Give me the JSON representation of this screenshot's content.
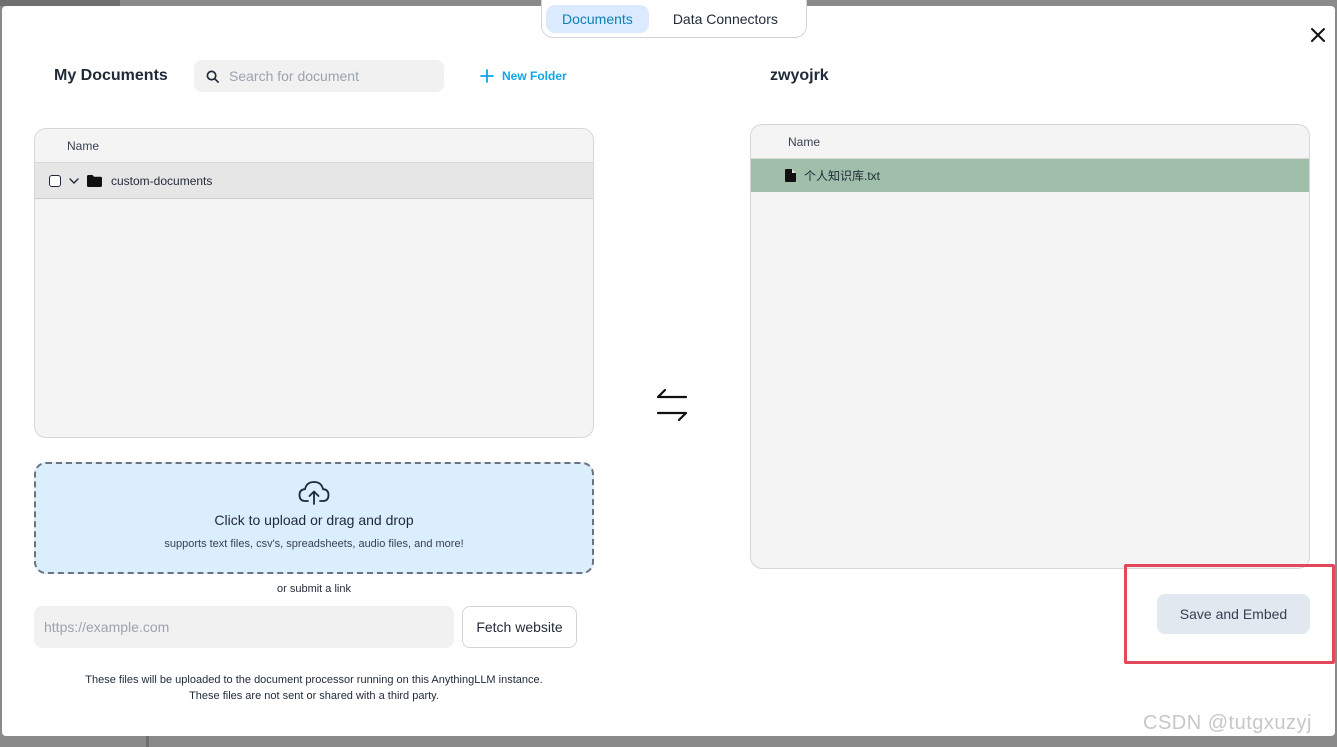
{
  "tabs": [
    {
      "label": "Documents",
      "active": true
    },
    {
      "label": "Data Connectors",
      "active": false
    }
  ],
  "left": {
    "title": "My Documents",
    "search_placeholder": "Search for document",
    "new_folder_label": "New Folder",
    "column_name": "Name",
    "folders": [
      {
        "name": "custom-documents",
        "expanded": true,
        "checked": false
      }
    ]
  },
  "upload": {
    "title": "Click to upload or drag and drop",
    "subtitle": "supports text files, csv's, spreadsheets, audio files, and more!",
    "or_link": "or submit a link",
    "link_placeholder": "https://example.com",
    "fetch_label": "Fetch website",
    "disclaimer_line1": "These files will be uploaded to the document processor running on this AnythingLLM instance.",
    "disclaimer_line2": "These files are not sent or shared with a third party."
  },
  "right": {
    "workspace_name": "zwyojrk",
    "column_name": "Name",
    "files": [
      {
        "name": "个人知识库.txt"
      }
    ],
    "save_label": "Save and Embed"
  },
  "icons": {
    "close": "close-icon",
    "search": "search-icon",
    "plus": "plus-icon",
    "swap": "swap-arrows-icon",
    "upload": "cloud-upload-icon",
    "folder": "folder-icon",
    "file": "file-icon",
    "chevron": "chevron-down-icon"
  },
  "colors": {
    "accent": "#0ea5e9",
    "tab_active_bg": "#dbeafe",
    "selected_file_bg": "#9fbfab",
    "upload_bg": "#dbeefc",
    "highlight": "#e5475a"
  },
  "watermark": "CSDN @tutgxuzyj"
}
